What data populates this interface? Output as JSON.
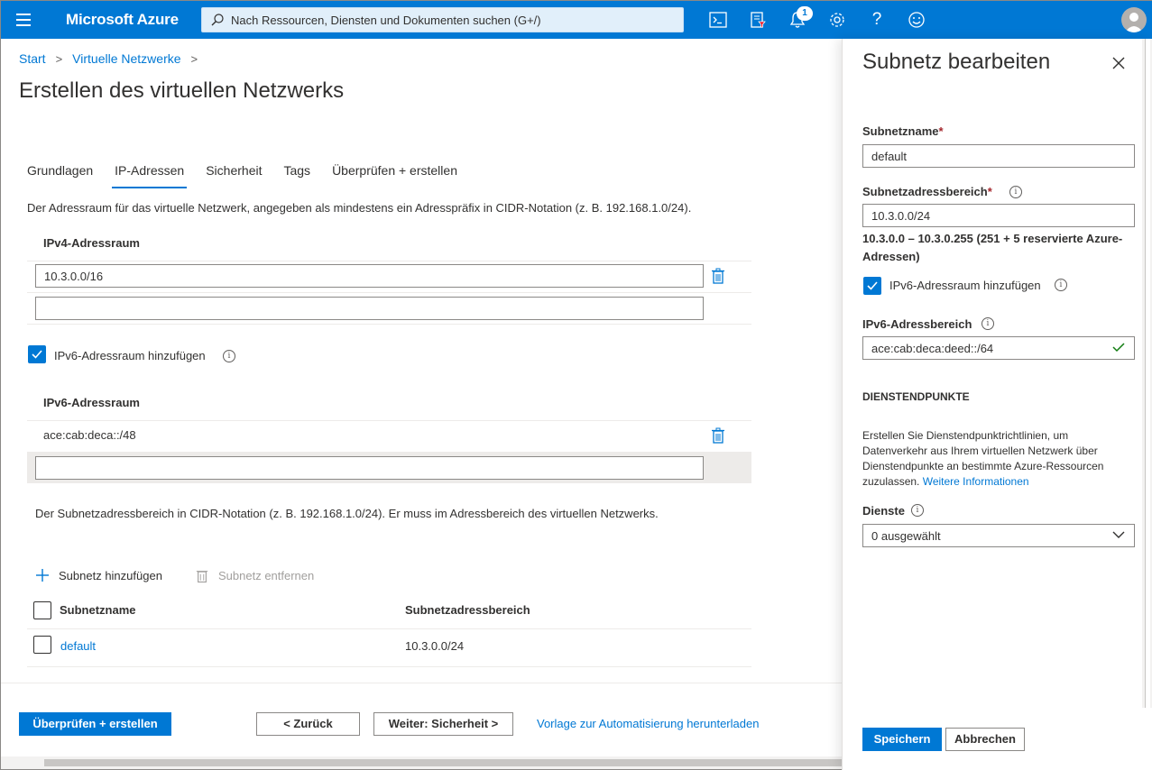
{
  "topbar": {
    "brand": "Microsoft Azure",
    "search_placeholder": "Nach Ressourcen, Diensten und Dokumenten suchen (G+/)",
    "notification_count": "1",
    "icons": [
      "cloud-shell-icon",
      "directory-filter-icon",
      "notifications-icon",
      "settings-icon",
      "help-icon",
      "feedback-icon"
    ]
  },
  "breadcrumb": [
    "Start",
    "Virtuelle Netzwerke"
  ],
  "page_title": "Erstellen des virtuellen Netzwerks",
  "tabs": [
    "Grundlagen",
    "IP-Adressen",
    "Sicherheit",
    "Tags",
    "Überprüfen + erstellen"
  ],
  "active_tab": "IP-Adressen",
  "ip": {
    "description": "Der Adressraum für das virtuelle Netzwerk, angegeben als mindestens ein Adresspräfix in CIDR-Notation (z. B. 192.168.1.0/24).",
    "ipv4_header": "IPv4-Adressraum",
    "ipv4_values": [
      "10.3.0.0/16",
      ""
    ],
    "ipv6_checkbox_label": "IPv6-Adressraum hinzufügen",
    "ipv6_checked": true,
    "ipv6_header": "IPv6-Adressraum",
    "ipv6_values": [
      "ace:cab:deca::/48",
      ""
    ],
    "subnet_description": "Der Subnetzadressbereich in CIDR-Notation (z. B. 192.168.1.0/24). Er muss im Adressbereich des virtuellen Netzwerks.",
    "add_subnet": "Subnetz hinzufügen",
    "remove_subnet": "Subnetz entfernen",
    "columns": [
      "Subnetzname",
      "Subnetzadressbereich"
    ],
    "rows": [
      {
        "name": "default",
        "range": "10.3.0.0/24"
      }
    ]
  },
  "footer": {
    "review_create": "Überprüfen + erstellen",
    "back": "<  Zurück",
    "next": "Weiter: Sicherheit >",
    "template_link": "Vorlage zur Automatisierung herunterladen"
  },
  "panel": {
    "title": "Subnetz bearbeiten",
    "name_label": "Subnetzname",
    "name_value": "default",
    "range_label": "Subnetzadressbereich",
    "range_value": "10.3.0.0/24",
    "range_note": "10.3.0.0 – 10.3.0.255 (251 + 5 reservierte Azure-Adressen)",
    "ipv6_checkbox_label": "IPv6-Adressraum hinzufügen",
    "ipv6_checked": true,
    "ipv6_range_label": "IPv6-Adressbereich",
    "ipv6_range_value": "ace:cab:deca:deed::/64",
    "endpoints_heading": "DIENSTENDPUNKTE",
    "endpoints_text": "Erstellen Sie Dienstendpunktrichtlinien, um Datenverkehr aus Ihrem virtuellen Netzwerk über Dienstendpunkte an bestimmte Azure-Ressourcen zuzulassen.",
    "more_info": "Weitere Informationen",
    "services_label": "Dienste",
    "services_value": "0 ausgewählt",
    "save": "Speichern",
    "cancel": "Abbrechen"
  },
  "colors": {
    "accent": "#0078d4",
    "text": "#323130",
    "required": "#a4262c",
    "valid": "#107c10"
  }
}
